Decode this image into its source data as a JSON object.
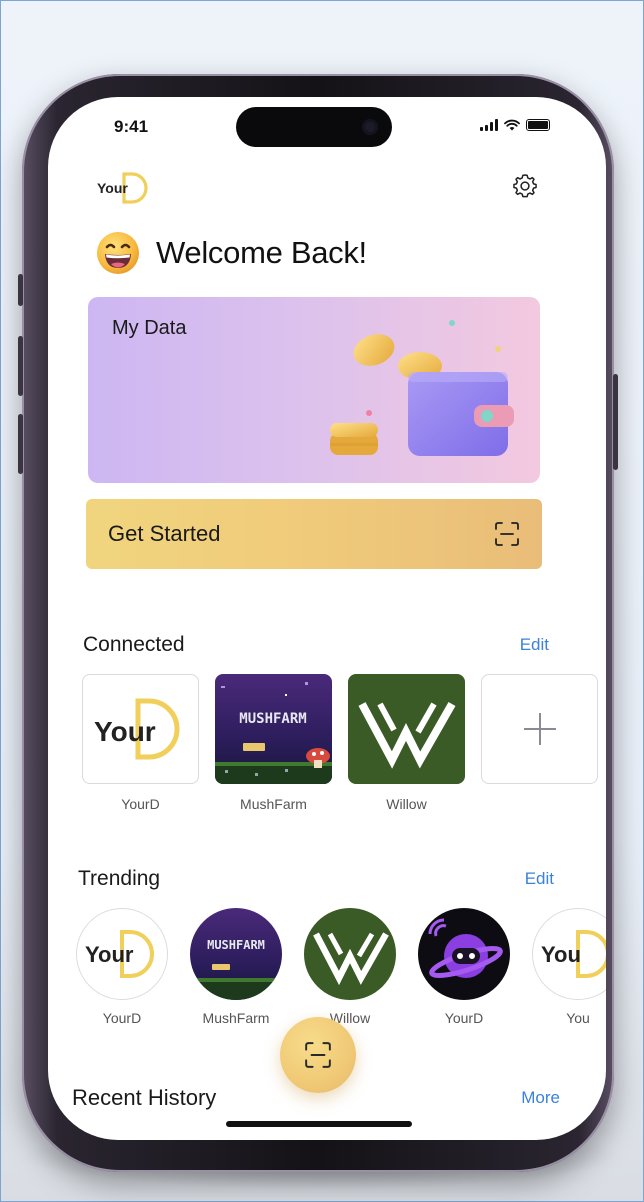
{
  "status_bar": {
    "time": "9:41"
  },
  "header": {
    "logo_text": "Your",
    "logo_mark": "D",
    "settings_icon": "gear-icon"
  },
  "welcome": {
    "emoji": "grinning-face",
    "text": "Welcome Back!"
  },
  "my_data_card": {
    "title": "My Data",
    "illustration": "wallet-with-coins"
  },
  "get_started": {
    "label": "Get Started",
    "icon": "scan-icon"
  },
  "connected": {
    "title": "Connected",
    "edit_label": "Edit",
    "items": [
      {
        "label": "YourD",
        "tile_text": "Your",
        "tile_mark": "D"
      },
      {
        "label": "MushFarm",
        "tile_text": "MUSHFARM"
      },
      {
        "label": "Willow",
        "tile_text": "W"
      },
      {
        "label": "",
        "tile_text": "+"
      }
    ]
  },
  "trending": {
    "title": "Trending",
    "edit_label": "Edit",
    "items": [
      {
        "label": "YourD",
        "tile_text": "Your",
        "tile_mark": "D"
      },
      {
        "label": "MushFarm",
        "tile_text": "MUSHFARM"
      },
      {
        "label": "Willow",
        "tile_text": "W"
      },
      {
        "label": "YourD"
      },
      {
        "label": "You",
        "tile_text": "You"
      }
    ]
  },
  "recent_history": {
    "title": "Recent History",
    "more_label": "More"
  },
  "colors": {
    "accent_yellow": "#f0c976",
    "link_blue": "#3b82d9",
    "willow_green": "#3a5a26",
    "card_lavender": "#cdb7f3",
    "card_pink": "#f3c9df"
  }
}
